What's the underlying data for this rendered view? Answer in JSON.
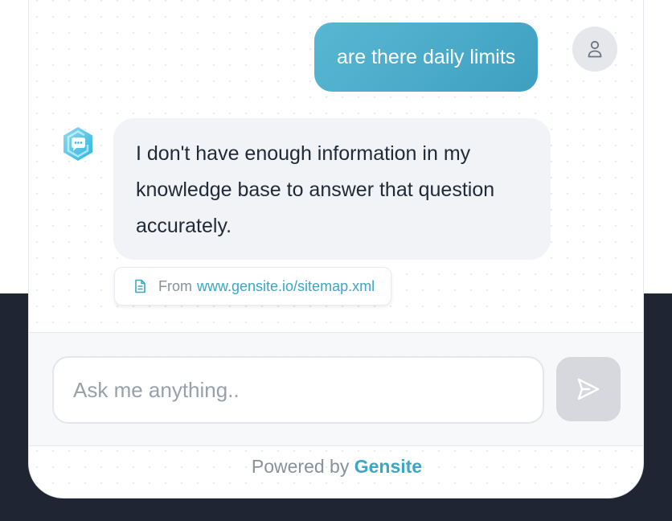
{
  "conversation": {
    "user_message": "are there daily limits",
    "bot_message": "I don't have enough information in my knowledge base to answer that question accurately.",
    "source": {
      "prefix": "From",
      "link_text": "www.gensite.io/sitemap.xml"
    }
  },
  "composer": {
    "placeholder": "Ask me anything..",
    "value": ""
  },
  "footer": {
    "powered_label": "Powered by",
    "brand": "Gensite"
  },
  "icons": {
    "user_avatar": "user-icon",
    "bot_avatar": "chat-bot-logo-icon",
    "source": "document-icon",
    "send": "send-icon"
  },
  "colors": {
    "accent": "#3aa7c5",
    "user_bubble": "#4aaecb",
    "bot_bubble": "#f1f3f6",
    "dark_background": "#1f2533",
    "send_button_disabled": "#d6d8de"
  }
}
